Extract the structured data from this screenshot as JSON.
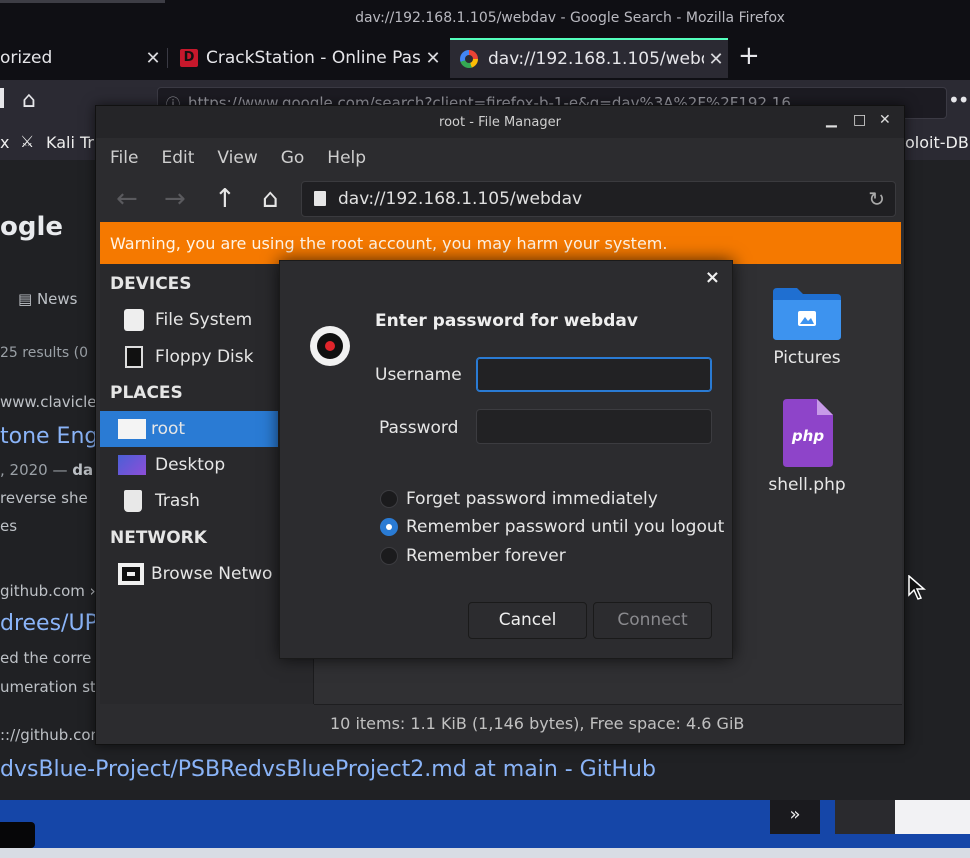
{
  "firefox": {
    "window_title": "dav://192.168.1.105/webdav - Google Search - Mozilla Firefox",
    "tabs": [
      {
        "label": "orized"
      },
      {
        "label": "CrackStation - Online Pas"
      },
      {
        "label": "dav://192.168.1.105/webd"
      }
    ],
    "url": "https://www.google.com/search?client=firefox-b-1-e&q=dav%3A%2F%2F192.16",
    "bookmarks": [
      {
        "label": "x"
      },
      {
        "label": "Kali Tr"
      },
      {
        "label": "oloit-DB"
      }
    ]
  },
  "google": {
    "logo": "ogle",
    "news_tab": "News",
    "results_count": "25 results (0",
    "result1_url": "www.clavicle",
    "result1_title": "tone Eng",
    "result1_date": ", 2020 —",
    "result1_date_bold": "da",
    "result1_snippet1": "reverse she",
    "result1_snippet2": "es",
    "result2_url": "github.com ›",
    "result2_title": "drees/UP",
    "result2_snippet1": "ed the corre",
    "result2_snippet2": "umeration st",
    "result3_url": ":://github.com",
    "result3_title": "dvsBlue-Project/PSBRedvsBlueProject2.md at main - GitHub"
  },
  "file_manager": {
    "title": "root - File Manager",
    "menu": [
      "File",
      "Edit",
      "View",
      "Go",
      "Help"
    ],
    "path": "dav://192.168.1.105/webdav",
    "warning": "Warning, you are using the root account, you may harm your system.",
    "sidebar": {
      "devices_heading": "DEVICES",
      "devices": [
        {
          "label": "File System"
        },
        {
          "label": "Floppy Disk"
        }
      ],
      "places_heading": "PLACES",
      "places": [
        {
          "label": "root"
        },
        {
          "label": "Desktop"
        },
        {
          "label": "Trash"
        }
      ],
      "network_heading": "NETWORK",
      "network": [
        {
          "label": "Browse Netwo"
        }
      ]
    },
    "files": [
      {
        "name": "Pictures",
        "icon": "folder-pictures-icon"
      },
      {
        "name": "shell.php",
        "icon": "php-file-icon",
        "badge": "php"
      }
    ],
    "status": "10 items: 1.1 KiB (1,146 bytes), Free space: 4.6 GiB"
  },
  "dialog": {
    "heading": "Enter password for webdav",
    "username_label": "Username",
    "username_value": "",
    "password_label": "Password",
    "password_value": "",
    "options": [
      {
        "label": "Forget password immediately",
        "selected": false
      },
      {
        "label": "Remember password until you logout",
        "selected": true
      },
      {
        "label": "Remember forever",
        "selected": false
      }
    ],
    "cancel": "Cancel",
    "connect": "Connect",
    "close": "×"
  },
  "taskbar": {
    "more": "»"
  },
  "colors": {
    "accent": "#2a7bd4",
    "warning": "#f57900",
    "google_link": "#8ab4f8",
    "taskbar": "#1546a8"
  }
}
